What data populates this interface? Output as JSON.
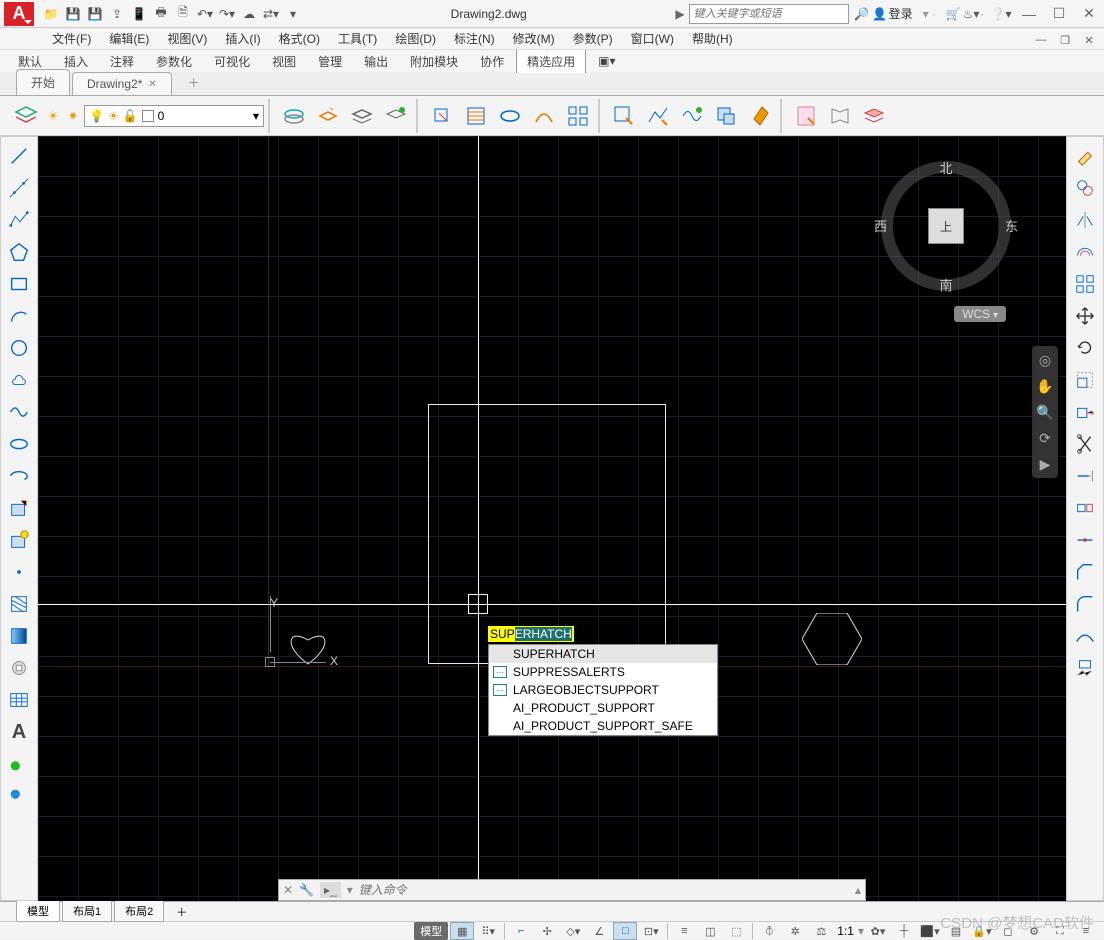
{
  "app": {
    "icon_letter": "A",
    "title": "Drawing2.dwg"
  },
  "search": {
    "placeholder": "键入关键字或短语"
  },
  "login": {
    "label": "登录"
  },
  "qat": [
    "folder",
    "save",
    "saveall",
    "export",
    "mobile",
    "print",
    "fileop",
    "undo",
    "redo",
    "cloud",
    "share",
    "arrow"
  ],
  "menus": [
    "文件(F)",
    "编辑(E)",
    "视图(V)",
    "插入(I)",
    "格式(O)",
    "工具(T)",
    "绘图(D)",
    "标注(N)",
    "修改(M)",
    "参数(P)",
    "窗口(W)",
    "帮助(H)"
  ],
  "ribbon_tabs": [
    "默认",
    "插入",
    "注释",
    "参数化",
    "可视化",
    "视图",
    "管理",
    "输出",
    "附加模块",
    "协作",
    "精选应用"
  ],
  "active_ribbon_tab": 10,
  "doc_tabs": [
    {
      "label": "开始",
      "closable": false
    },
    {
      "label": "Drawing2*",
      "closable": true
    }
  ],
  "layer": {
    "current": "0",
    "color": "#ffffff"
  },
  "viewcube": {
    "n": "北",
    "s": "南",
    "e": "东",
    "w": "西",
    "top": "上",
    "wcs": "WCS"
  },
  "command": {
    "typed": "SUP",
    "completion": "ERHATCH"
  },
  "autocomplete": [
    {
      "label": "SUPERHATCH",
      "icon": false,
      "selected": true
    },
    {
      "label": "SUPPRESSALERTS",
      "icon": true
    },
    {
      "label": "LARGEOBJECTSUPPORT",
      "icon": true
    },
    {
      "label": "AI_PRODUCT_SUPPORT",
      "icon": false
    },
    {
      "label": "AI_PRODUCT_SUPPORT_SAFE",
      "icon": false
    }
  ],
  "cmdline": {
    "placeholder": "键入命令"
  },
  "ucs": {
    "x": "X",
    "y": "Y"
  },
  "layout_tabs": [
    "模型",
    "布局1",
    "布局2"
  ],
  "active_layout": 0,
  "status": {
    "model": "模型",
    "scale": "1:1"
  },
  "watermark": "CSDN @梦想CAD软件"
}
